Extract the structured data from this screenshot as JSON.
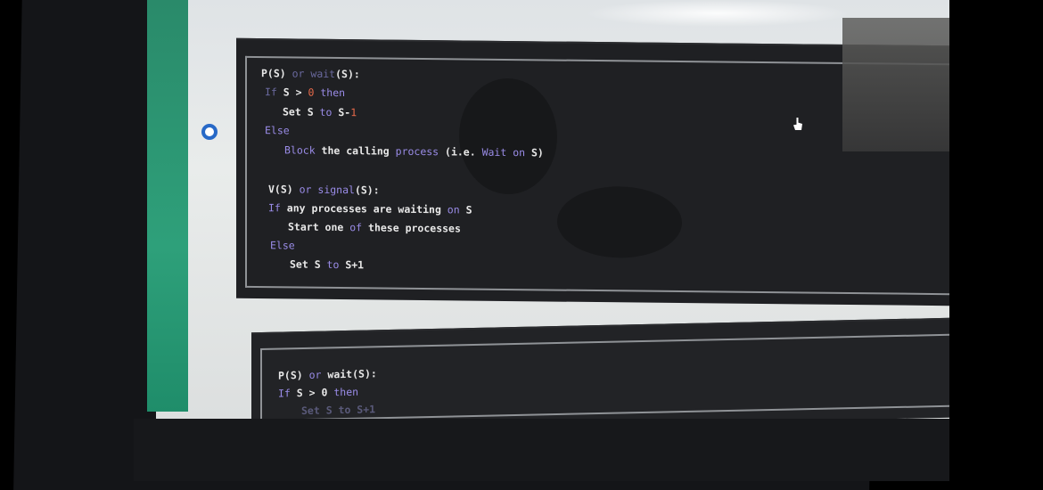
{
  "block1": {
    "lines": [
      {
        "parts": [
          {
            "t": "P(S) ",
            "c": ""
          },
          {
            "t": "or ",
            "c": "kwd"
          },
          {
            "t": "wait",
            "c": "kwd"
          },
          {
            "t": "(S):",
            "c": ""
          }
        ]
      },
      {
        "parts": [
          {
            "t": "If ",
            "c": "kwd"
          },
          {
            "t": "S > ",
            "c": ""
          },
          {
            "t": "0 ",
            "c": "num"
          },
          {
            "t": "then",
            "c": "kw"
          }
        ]
      },
      {
        "parts": [
          {
            "t": "Set S ",
            "c": ""
          },
          {
            "t": "to ",
            "c": "kw"
          },
          {
            "t": "S-",
            "c": ""
          },
          {
            "t": "1",
            "c": "num"
          }
        ]
      },
      {
        "parts": [
          {
            "t": "Else",
            "c": "kw"
          }
        ]
      },
      {
        "parts": [
          {
            "t": "Block ",
            "c": "kw"
          },
          {
            "t": "the calling ",
            "c": ""
          },
          {
            "t": "process ",
            "c": "kw"
          },
          {
            "t": "(i.e. ",
            "c": ""
          },
          {
            "t": "Wait on ",
            "c": "kw"
          },
          {
            "t": "S)",
            "c": ""
          }
        ]
      },
      {
        "parts": [
          {
            "t": "V(S) ",
            "c": ""
          },
          {
            "t": "or ",
            "c": "kw"
          },
          {
            "t": "signal",
            "c": "kw"
          },
          {
            "t": "(S):",
            "c": ""
          }
        ]
      },
      {
        "parts": [
          {
            "t": "If ",
            "c": "kw"
          },
          {
            "t": "any processes are waiting ",
            "c": ""
          },
          {
            "t": "on ",
            "c": "kw"
          },
          {
            "t": "S",
            "c": ""
          }
        ]
      },
      {
        "parts": [
          {
            "t": "Start one ",
            "c": ""
          },
          {
            "t": "of ",
            "c": "kw"
          },
          {
            "t": "these processes",
            "c": ""
          }
        ]
      },
      {
        "parts": [
          {
            "t": "Else",
            "c": "kw"
          }
        ]
      },
      {
        "parts": [
          {
            "t": "Set S ",
            "c": ""
          },
          {
            "t": "to ",
            "c": "kw"
          },
          {
            "t": "S+1",
            "c": ""
          }
        ]
      }
    ]
  },
  "block2": {
    "lines": [
      {
        "parts": [
          {
            "t": "P(S) ",
            "c": ""
          },
          {
            "t": "or ",
            "c": "kw"
          },
          {
            "t": "wait",
            "c": ""
          },
          {
            "t": "(S):",
            "c": ""
          }
        ]
      },
      {
        "parts": [
          {
            "t": "If ",
            "c": "kw"
          },
          {
            "t": "S > ",
            "c": ""
          },
          {
            "t": "0 ",
            "c": ""
          },
          {
            "t": "then",
            "c": "kw"
          }
        ]
      },
      {
        "parts": [
          {
            "t": "Set S to S+1",
            "c": "faint"
          }
        ]
      }
    ]
  }
}
